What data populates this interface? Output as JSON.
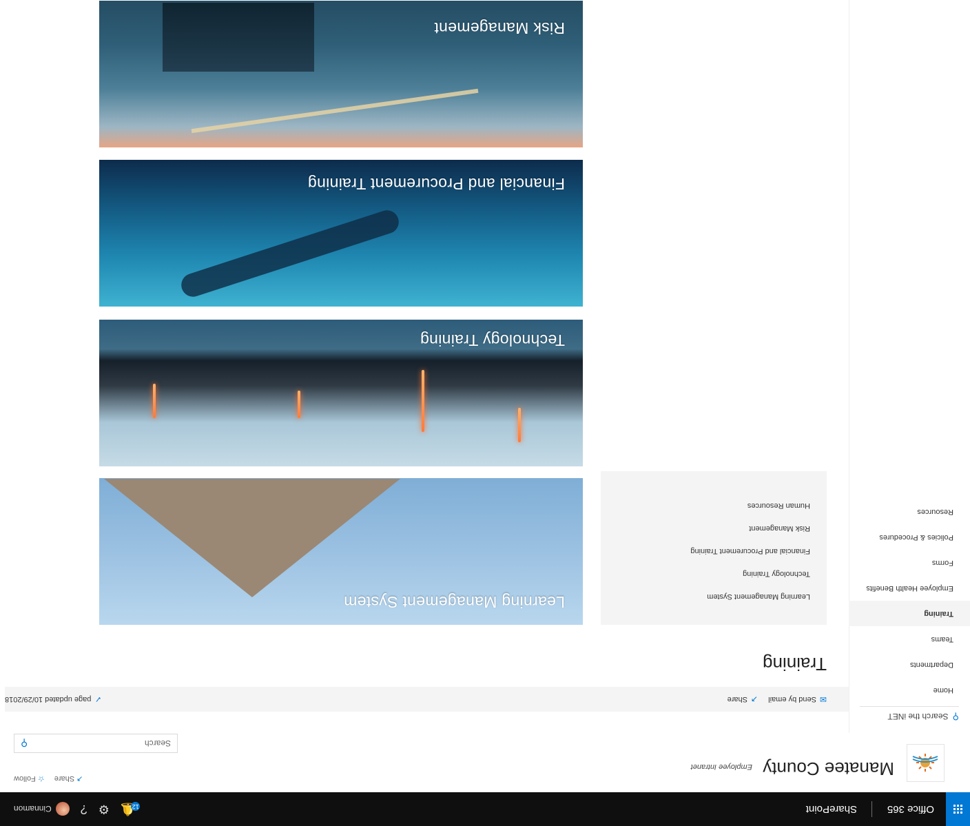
{
  "suite_bar": {
    "brand": "Office 365",
    "app_name": "SharePoint",
    "notification_count": "12",
    "user_name": "Cinnamon"
  },
  "site_header": {
    "title": "Manatee County",
    "description": "Employee Intranet",
    "follow_label": "Follow",
    "share_label": "Share",
    "search_placeholder": "Search"
  },
  "left_nav": {
    "search_placeholder": "Search the iNET",
    "items": [
      {
        "label": "Home"
      },
      {
        "label": "Departments"
      },
      {
        "label": "Teams"
      },
      {
        "label": "Training",
        "active": true
      },
      {
        "label": "Employee Health Benefits"
      },
      {
        "label": "Forms"
      },
      {
        "label": "Policies & Procedures"
      },
      {
        "label": "Resources"
      }
    ]
  },
  "command_bar": {
    "page_updated": "page updated 10/29/2018",
    "share_label": "Share",
    "send_email_label": "Send by email"
  },
  "page": {
    "title": "Training",
    "quick_links": [
      {
        "label": "Learning Management System"
      },
      {
        "label": "Technology Training"
      },
      {
        "label": "Financial and Procurement Training"
      },
      {
        "label": "Risk Management"
      },
      {
        "label": "Human Resources"
      }
    ],
    "tiles": [
      {
        "caption": "Learning Management System"
      },
      {
        "caption": "Technology Training"
      },
      {
        "caption": "Financial and Procurement Training"
      },
      {
        "caption": "Risk Management"
      }
    ]
  },
  "colors": {
    "accent": "#0078d4",
    "suite_bar_bg": "#0f0f0f",
    "panel_bg": "#f4f4f4"
  },
  "icons": [
    "waffle-icon",
    "bell-icon",
    "gear-icon",
    "help-icon",
    "star-icon",
    "share-icon",
    "search-icon",
    "email-icon",
    "pencil-icon"
  ]
}
